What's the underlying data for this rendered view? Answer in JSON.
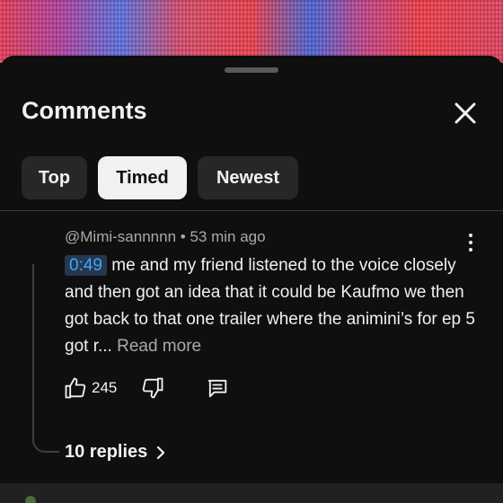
{
  "sheet": {
    "title": "Comments"
  },
  "filters": [
    {
      "label": "Top",
      "active": false
    },
    {
      "label": "Timed",
      "active": true
    },
    {
      "label": "Newest",
      "active": false
    }
  ],
  "comment": {
    "author": "@Mimi-sannnnn",
    "separator": "•",
    "time_ago": "53 min ago",
    "timestamp": "0:49",
    "text": " me and my friend listened to the voice closely and then got an idea that it could be Kaufmo we then got back to that one trailer where the animini’s for ep 5 got r... ",
    "read_more": "Read more",
    "like_count": "245",
    "replies_label": "10 replies"
  },
  "icons": {
    "close": "close-icon",
    "more": "more-vertical-icon",
    "like": "thumbs-up-icon",
    "dislike": "thumbs-down-icon",
    "reply": "comment-reply-icon",
    "chevron": "chevron-right-icon"
  },
  "colors": {
    "background": "#0f0f0f",
    "chip": "#272727",
    "chip_active": "#f1f1f1",
    "link_blue": "#3ea6ff",
    "secondary_text": "#aaaaaa"
  }
}
